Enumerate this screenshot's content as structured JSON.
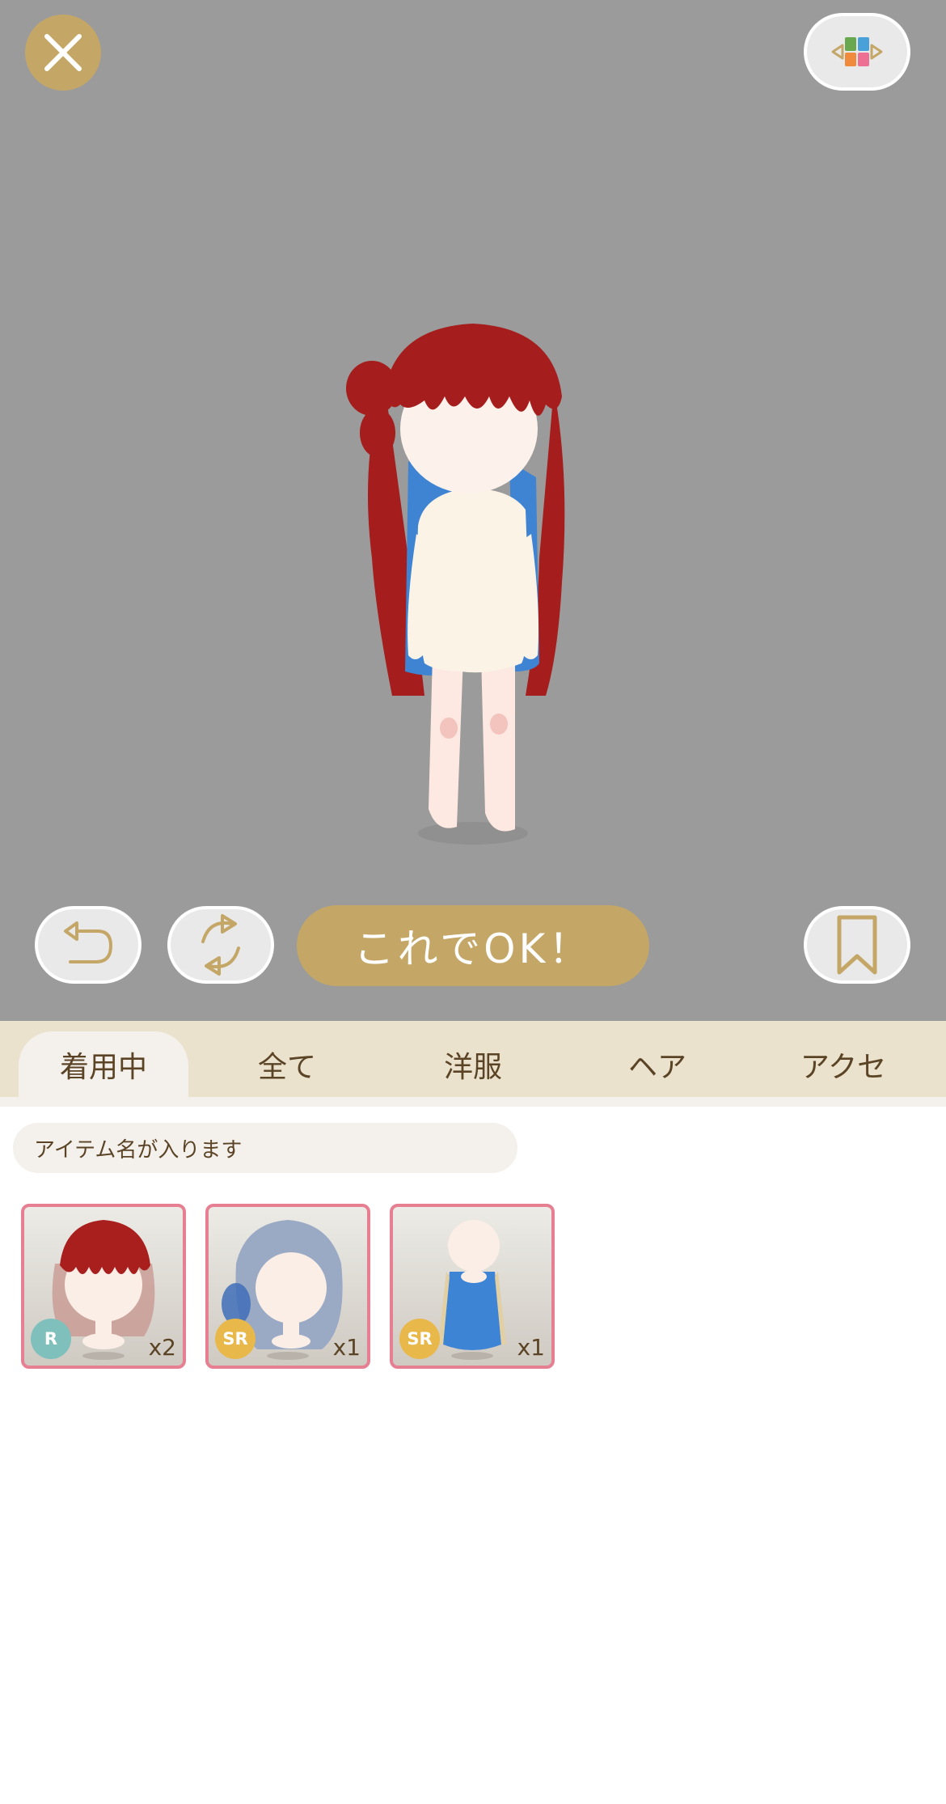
{
  "topbar": {
    "close_icon": "close-icon",
    "grid_icon": "color-grid-icon"
  },
  "controls": {
    "undo_icon": "undo-icon",
    "reset_icon": "refresh-icon",
    "ok_label": "これでOK！",
    "bookmark_icon": "bookmark-icon"
  },
  "tabs": [
    {
      "label": "着用中",
      "active": true
    },
    {
      "label": "全て",
      "active": false
    },
    {
      "label": "洋服",
      "active": false
    },
    {
      "label": "ヘア",
      "active": false
    },
    {
      "label": "アクセ",
      "active": false
    }
  ],
  "search": {
    "placeholder": "アイテム名が入ります"
  },
  "items": [
    {
      "rarity": "R",
      "rarity_color": "#7fc0bd",
      "count": "x2",
      "hair_color": "#a91f1e"
    },
    {
      "rarity": "SR",
      "rarity_color": "#e8b84b",
      "count": "x1",
      "hair_color": "#9aa9c4"
    },
    {
      "rarity": "SR",
      "rarity_color": "#e8b84b",
      "count": "x1",
      "hair_color": "#3e84d4"
    }
  ],
  "colors": {
    "accent": "#c4a767",
    "tab_bar": "#ebe2cd",
    "text": "#5b4426",
    "item_border": "#e77f93",
    "stage": "#9b9b9b"
  }
}
